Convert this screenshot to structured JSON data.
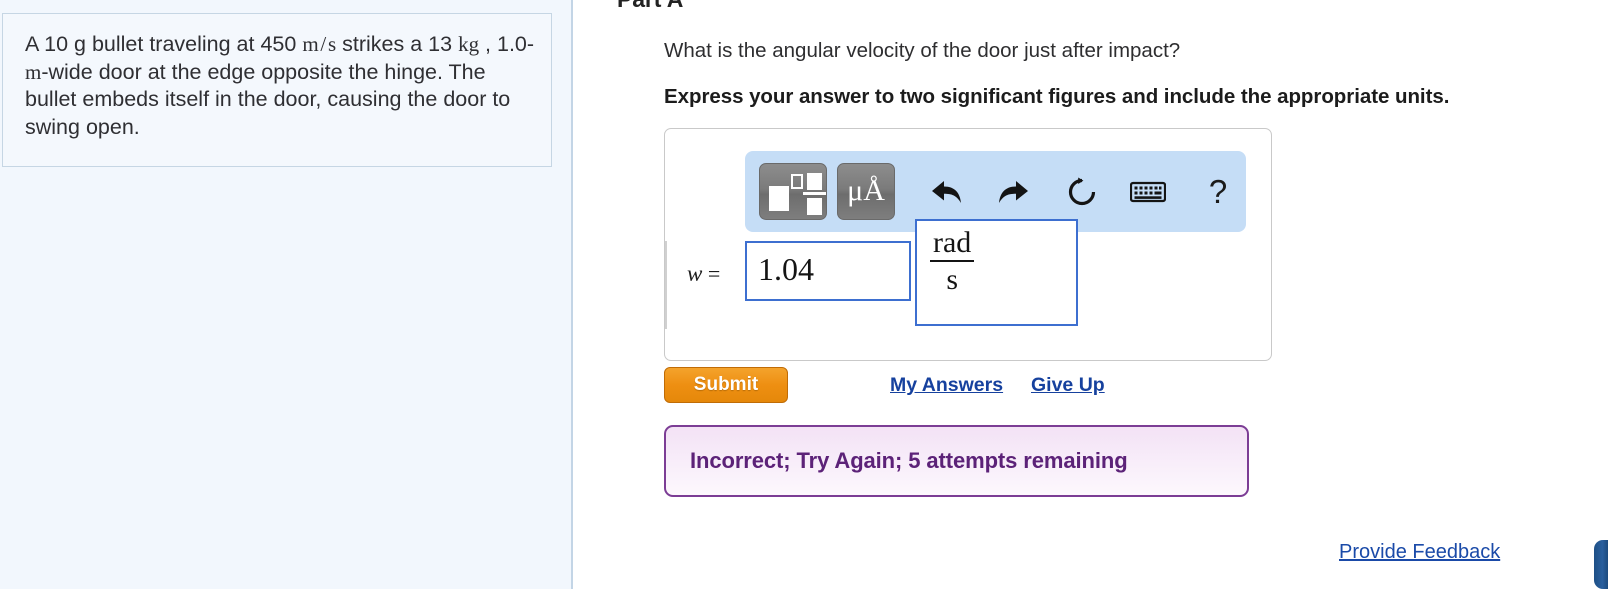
{
  "problem": {
    "text_parts": [
      {
        "t": "A 10 g bullet traveling at 450 ",
        "math": false
      },
      {
        "t": "m/s",
        "math": true
      },
      {
        "t": " strikes a 13 ",
        "math": false
      },
      {
        "t": "kg",
        "math": true
      },
      {
        "t": " , 1.0-",
        "math": false
      },
      {
        "t": "m",
        "math": true
      },
      {
        "t": "-wide door at the edge opposite the hinge. The bullet embeds itself in the door, causing the door to swing open.",
        "math": false
      }
    ],
    "full_text": "A 10 g bullet traveling at 450 m/s strikes a 13 kg , 1.0-m-wide door at the edge opposite the hinge. The bullet embeds itself in the door, causing the door to swing open."
  },
  "part": {
    "heading": "Part A",
    "question": "What is the angular velocity of the door just after impact?",
    "instruction": "Express your answer to two significant figures and include the appropriate units."
  },
  "toolbar": {
    "template_button": "math-template",
    "units_button": "μÅ",
    "undo": "undo-arrow",
    "redo": "redo-arrow",
    "reset": "refresh-arrow",
    "keyboard": "keyboard",
    "help": "?"
  },
  "answer": {
    "variable_label": "w",
    "equals": "=",
    "value": "1.04",
    "units_numerator": "rad",
    "units_denominator": "s"
  },
  "actions": {
    "submit_label": "Submit",
    "my_answers_label": "My Answers",
    "give_up_label": "Give Up"
  },
  "feedback": {
    "message": "Incorrect; Try Again; 5 attempts remaining",
    "border_color": "#7c3d95",
    "text_color": "#5c2278"
  },
  "footer": {
    "provide_feedback_label": "Provide Feedback"
  },
  "colors": {
    "panel_background": "#f2f7fd",
    "toolbar_background": "#c5ddf6",
    "submit_orange": "#ee8f12",
    "link_blue": "#16419e"
  }
}
